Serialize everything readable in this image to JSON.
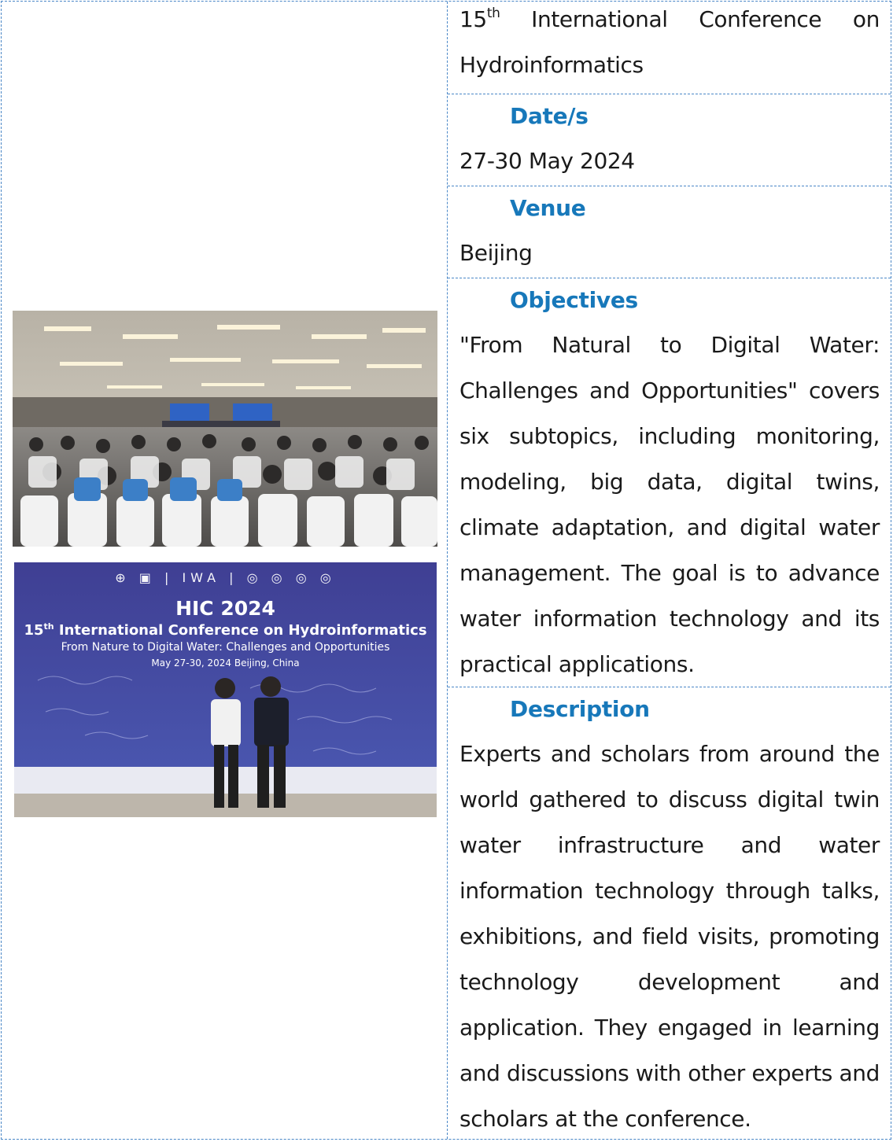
{
  "conference": {
    "title_line1_parts": [
      "15",
      "th",
      "International",
      "Conference",
      "on"
    ],
    "title_line2": "Hydroinformatics"
  },
  "dates": {
    "heading": "Date/s",
    "value": "27-30 May 2024"
  },
  "venue": {
    "heading": "Venue",
    "value": "Beijing"
  },
  "objectives": {
    "heading": "Objectives",
    "text": "\"From Natural to Digital Water: Challenges and Opportunities\" covers six subtopics, including monitoring, modeling, big data, digital twins, climate adaptation, and digital water management. The goal is to advance water information technology and its practical applications."
  },
  "description": {
    "heading": "Description",
    "text": "Experts and scholars from around the world gathered to discuss digital twin water infrastructure and water information technology through talks, exhibitions, and field visits, promoting technology development and application. They engaged in learning and discussions with other experts and scholars at the conference."
  },
  "banner": {
    "logos": "⊕ ▣ | IWA | ◎ ◎ ◎ ◎",
    "title": "HIC 2024",
    "conference_prefix": "15",
    "conference_sup": "th",
    "conference_rest": " International Conference on Hydroinformatics",
    "theme": "From Nature to Digital Water: Challenges and Opportunities",
    "date": "May 27-30, 2024  Beijing, China"
  },
  "colors": {
    "heading": "#1778ba",
    "border": "#4a87c7",
    "banner_bg": "#3f3f93"
  }
}
